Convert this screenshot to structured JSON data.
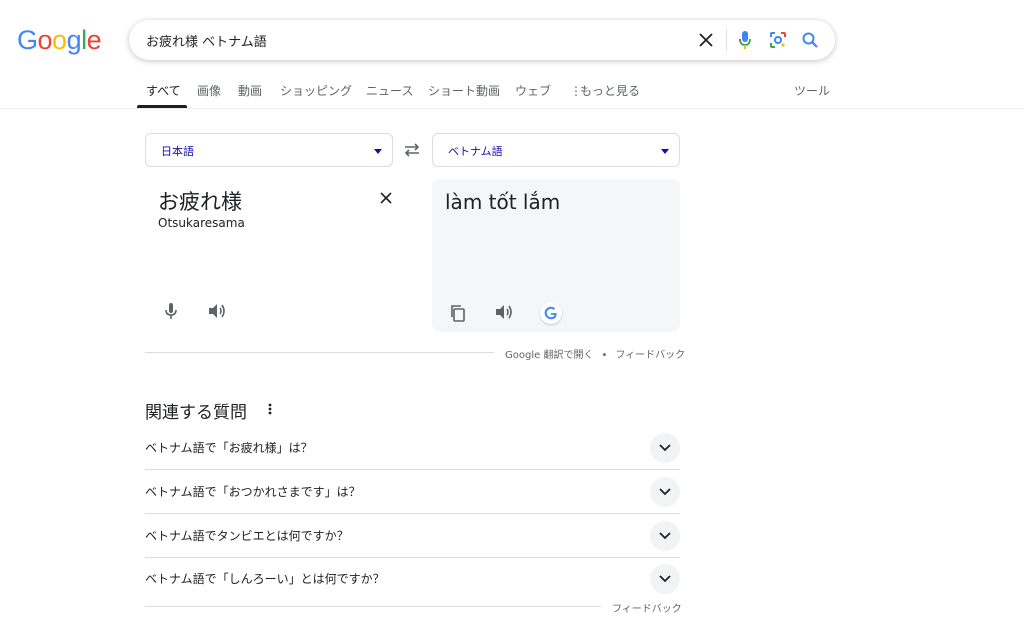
{
  "logo": {
    "letters": [
      "G",
      "o",
      "o",
      "g",
      "l",
      "e"
    ]
  },
  "search": {
    "query": "お疲れ様 ベトナム語"
  },
  "tabs": [
    {
      "label": "すべて"
    },
    {
      "label": "画像"
    },
    {
      "label": "動画"
    },
    {
      "label": "ショッピング"
    },
    {
      "label": "ニュース"
    },
    {
      "label": "ショート動画"
    },
    {
      "label": "ウェブ"
    },
    {
      "label": "もっと見る"
    }
  ],
  "tools_label": "ツール",
  "translator": {
    "source_lang": "日本語",
    "target_lang": "ベトナム語",
    "source_text": "お疲れ様",
    "source_romanization": "Otsukaresama",
    "target_text": "làm tốt lắm",
    "footer_open": "Google 翻訳で開く",
    "footer_feedback": "フィードバック"
  },
  "related": {
    "title": "関連する質問",
    "questions": [
      {
        "text": "ベトナム語で「お疲れ様」は？"
      },
      {
        "text": "ベトナム語で「おつかれさまです」は？"
      },
      {
        "text": "ベトナム語でタンビエとは何ですか？"
      },
      {
        "text": "ベトナム語で「しんろーい」とは何ですか？"
      }
    ],
    "feedback": "フィードバック"
  },
  "colors": {
    "link": "#1a0dab",
    "blue": "#4285f4",
    "red": "#ea4335",
    "yellow": "#fbbc05",
    "green": "#34a853"
  }
}
